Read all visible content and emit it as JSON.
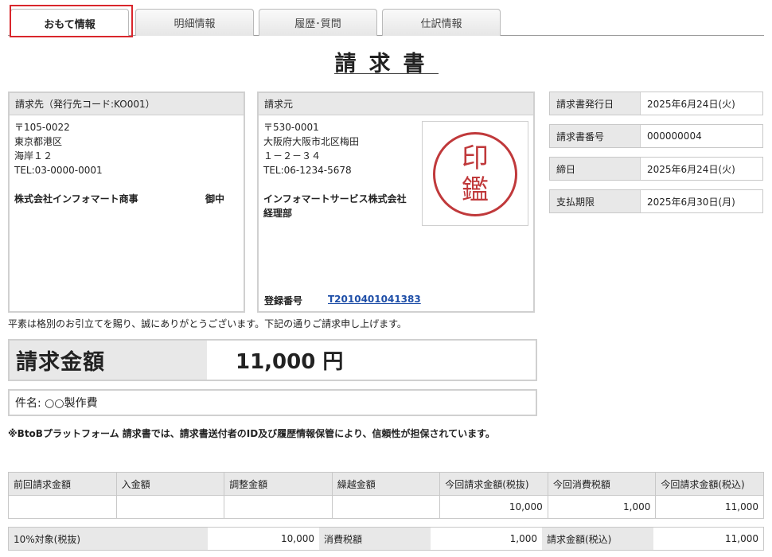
{
  "tabs": [
    {
      "label": "おもて情報",
      "active": true
    },
    {
      "label": "明細情報",
      "active": false
    },
    {
      "label": "履歴･質問",
      "active": false
    },
    {
      "label": "仕訳情報",
      "active": false
    }
  ],
  "document": {
    "title": "請求書"
  },
  "recipient": {
    "header": "請求先（発行先コード:KO001）",
    "postal": "〒105-0022",
    "addr1": "東京都港区",
    "addr2": "海岸１２",
    "tel": "TEL:03-0000-0001",
    "company": "株式会社インフォマート商事",
    "honorific": "御中"
  },
  "issuer": {
    "header": "請求元",
    "postal": "〒530-0001",
    "addr1": "大阪府大阪市北区梅田",
    "addr2": "１－２－３４",
    "tel": "TEL:06-1234-5678",
    "company": "インフォマートサービス株式会社",
    "dept": "経理部",
    "reg_label": "登録番号",
    "reg_number": "T2010401041383",
    "stamp_top": "印",
    "stamp_bottom": "鑑"
  },
  "info": [
    {
      "label": "請求書発行日",
      "value": "2025年6月24日(火)"
    },
    {
      "label": "請求書番号",
      "value": "000000004"
    },
    {
      "label": "締日",
      "value": "2025年6月24日(火)"
    },
    {
      "label": "支払期限",
      "value": "2025年6月30日(月)"
    }
  ],
  "greeting": "平素は格別のお引立てを賜り、誠にありがとうございます。下記の通りご請求申し上げます。",
  "amount": {
    "label": "請求金額",
    "value": "11,000 円"
  },
  "subject": "件名: ○○製作費",
  "note": "※BtoBプラットフォーム 請求書では、請求書送付者のID及び履歴情報保管により、信頼性が担保されています。",
  "summary": {
    "headers": [
      "前回請求金額",
      "入金額",
      "調整金額",
      "繰越金額",
      "今回請求金額(税抜)",
      "今回消費税額",
      "今回請求金額(税込)"
    ],
    "values": [
      "",
      "",
      "",
      "",
      "10,000",
      "1,000",
      "11,000"
    ]
  },
  "tax": {
    "target_label": "10%対象(税抜)",
    "target_value": "10,000",
    "tax_label": "消費税額",
    "tax_value": "1,000",
    "total_label": "請求金額(税込)",
    "total_value": "11,000"
  }
}
